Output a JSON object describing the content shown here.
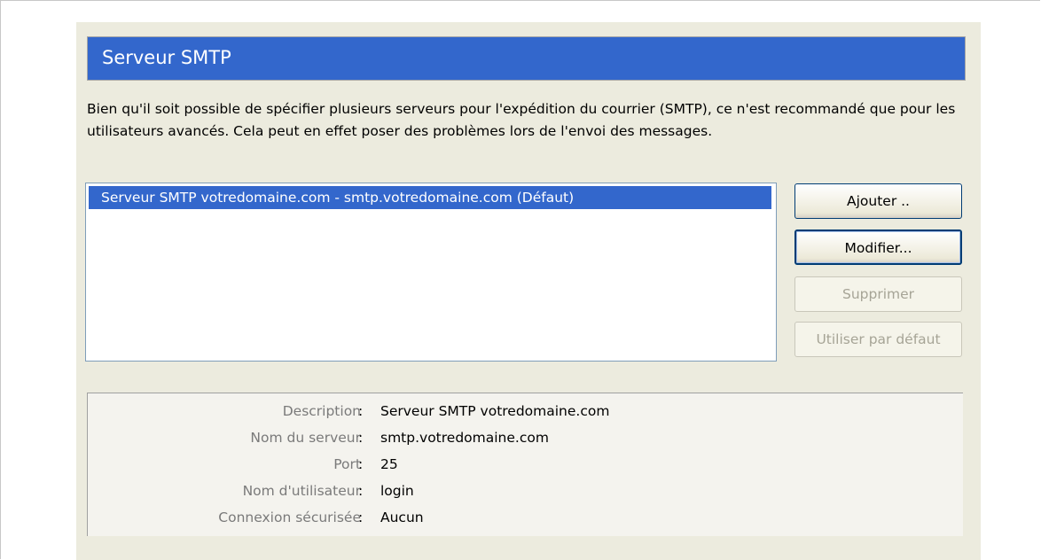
{
  "header": {
    "title": "Serveur SMTP"
  },
  "description": "Bien qu'il soit possible de spécifier plusieurs serveurs pour l'expédition du courrier (SMTP), ce n'est recommandé que pour les utilisateurs avancés. Cela peut en effet poser des problèmes lors de l'envoi des messages.",
  "server_list": {
    "items": [
      {
        "label": "Serveur SMTP votredomaine.com - smtp.votredomaine.com (Défaut)",
        "selected": true
      }
    ]
  },
  "buttons": {
    "add": {
      "label": "Ajouter ..",
      "enabled": true
    },
    "edit": {
      "label": "Modifier...",
      "enabled": true
    },
    "delete": {
      "label": "Supprimer",
      "enabled": false
    },
    "set_default": {
      "label": "Utiliser par défaut",
      "enabled": false
    }
  },
  "details": {
    "separator": ":",
    "rows": [
      {
        "label": "Description",
        "value": "Serveur SMTP votredomaine.com"
      },
      {
        "label": "Nom du serveur",
        "value": "smtp.votredomaine.com"
      },
      {
        "label": "Port",
        "value": "25"
      },
      {
        "label": "Nom d'utilisateur",
        "value": "login"
      },
      {
        "label": "Connexion sécurisée",
        "value": "Aucun"
      }
    ]
  },
  "colors": {
    "header_bg": "#3367cc",
    "selection_bg": "#3367cc",
    "panel_bg": "#ecebde"
  }
}
